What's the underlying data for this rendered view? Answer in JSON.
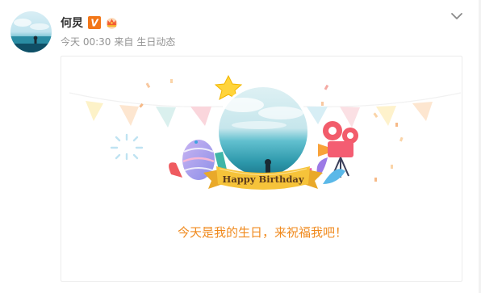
{
  "post": {
    "author_name": "何炅",
    "verified_badge": "V",
    "time_label": "今天 00:30",
    "source_prefix": "来自",
    "source_name": "生日动态",
    "icons": {
      "verified": "verified-v-icon",
      "member": "crown-icon",
      "more": "chevron-down-icon"
    }
  },
  "card": {
    "banner_text": "Happy Birthday",
    "caption": "今天是我的生日，来祝福我吧！"
  },
  "colors": {
    "accent_orange": "#f08a1e",
    "ribbon_yellow": "#f6c33a",
    "verified_orange": "#f27618",
    "meta_gray": "#939393"
  }
}
